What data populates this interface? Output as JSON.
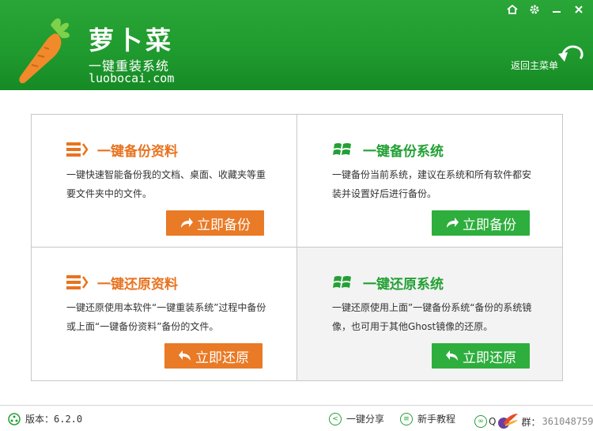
{
  "header": {
    "brand_name": "萝卜菜",
    "slogan": "一键重装系统",
    "site": "luobocai.com",
    "back_label": "返回主菜单",
    "controls": [
      "home-icon",
      "gear-icon",
      "minimize-icon",
      "close-icon"
    ]
  },
  "cards": {
    "backup_data": {
      "title": "一键备份资料",
      "desc": "一键快速智能备份我的文档、桌面、收藏夹等重要文件夹中的文件。",
      "button": "立即备份"
    },
    "backup_system": {
      "title": "一键备份系统",
      "desc": "一键备份当前系统，建议在系统和所有软件都安装并设置好后进行备份。",
      "button": "立即备份"
    },
    "restore_data": {
      "title": "一键还原资料",
      "desc": "一键还原使用本软件“一键重装系统”过程中备份或上面“一键备份资料”备份的文件。",
      "button": "立即还原"
    },
    "restore_system": {
      "title": "一键还原系统",
      "desc": "一键还原使用上面”一键备份系统“备份的系统镜像，也可用于其他Ghost镜像的还原。",
      "button": "立即还原"
    }
  },
  "status": {
    "version": "版本：6.2.0",
    "share": "一键分享",
    "tutorial": "新手教程",
    "qq_label": "Q",
    "qq_group": "群：",
    "qq_number": "361048759"
  },
  "colors": {
    "header_green": "#1f9a2e",
    "accent_orange": "#e97a26",
    "accent_green": "#2eae3d"
  }
}
